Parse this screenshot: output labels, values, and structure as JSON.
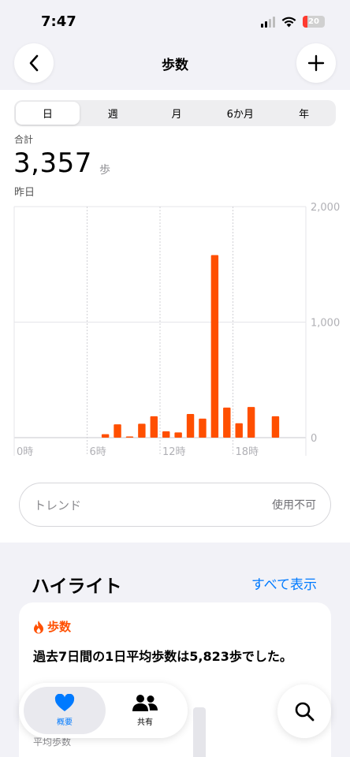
{
  "status_bar": {
    "time": "7:47",
    "battery": "20"
  },
  "nav": {
    "title": "歩数"
  },
  "segments": [
    "日",
    "週",
    "月",
    "6か月",
    "年"
  ],
  "summary": {
    "label": "合計",
    "value": "3,357",
    "unit": "歩",
    "date": "昨日"
  },
  "chart_data": {
    "type": "bar",
    "x_ticks": [
      "0時",
      "6時",
      "12時",
      "18時"
    ],
    "y_ticks": [
      "0",
      "1,000",
      "2,000"
    ],
    "ylim": [
      0,
      2000
    ],
    "color": "#ff4f00",
    "bars": [
      {
        "hour": 7,
        "value": 30
      },
      {
        "hour": 8,
        "value": 115
      },
      {
        "hour": 9,
        "value": 5
      },
      {
        "hour": 10,
        "value": 120
      },
      {
        "hour": 11,
        "value": 185
      },
      {
        "hour": 12,
        "value": 55
      },
      {
        "hour": 13,
        "value": 45
      },
      {
        "hour": 14,
        "value": 205
      },
      {
        "hour": 15,
        "value": 165
      },
      {
        "hour": 16,
        "value": 1580
      },
      {
        "hour": 17,
        "value": 260
      },
      {
        "hour": 18,
        "value": 125
      },
      {
        "hour": 19,
        "value": 265
      },
      {
        "hour": 21,
        "value": 185
      }
    ]
  },
  "trend": {
    "label": "トレンド",
    "value": "使用不可"
  },
  "highlights": {
    "title": "ハイライト",
    "show_all": "すべて表示",
    "card": {
      "category": "歩数",
      "text": "過去7日間の1日平均歩数は5,823歩でした。",
      "sub": "平均歩数"
    }
  },
  "tabbar": {
    "summary": "概要",
    "sharing": "共有"
  },
  "colors": {
    "accent": "#007aff",
    "steps": "#ff4f00"
  }
}
